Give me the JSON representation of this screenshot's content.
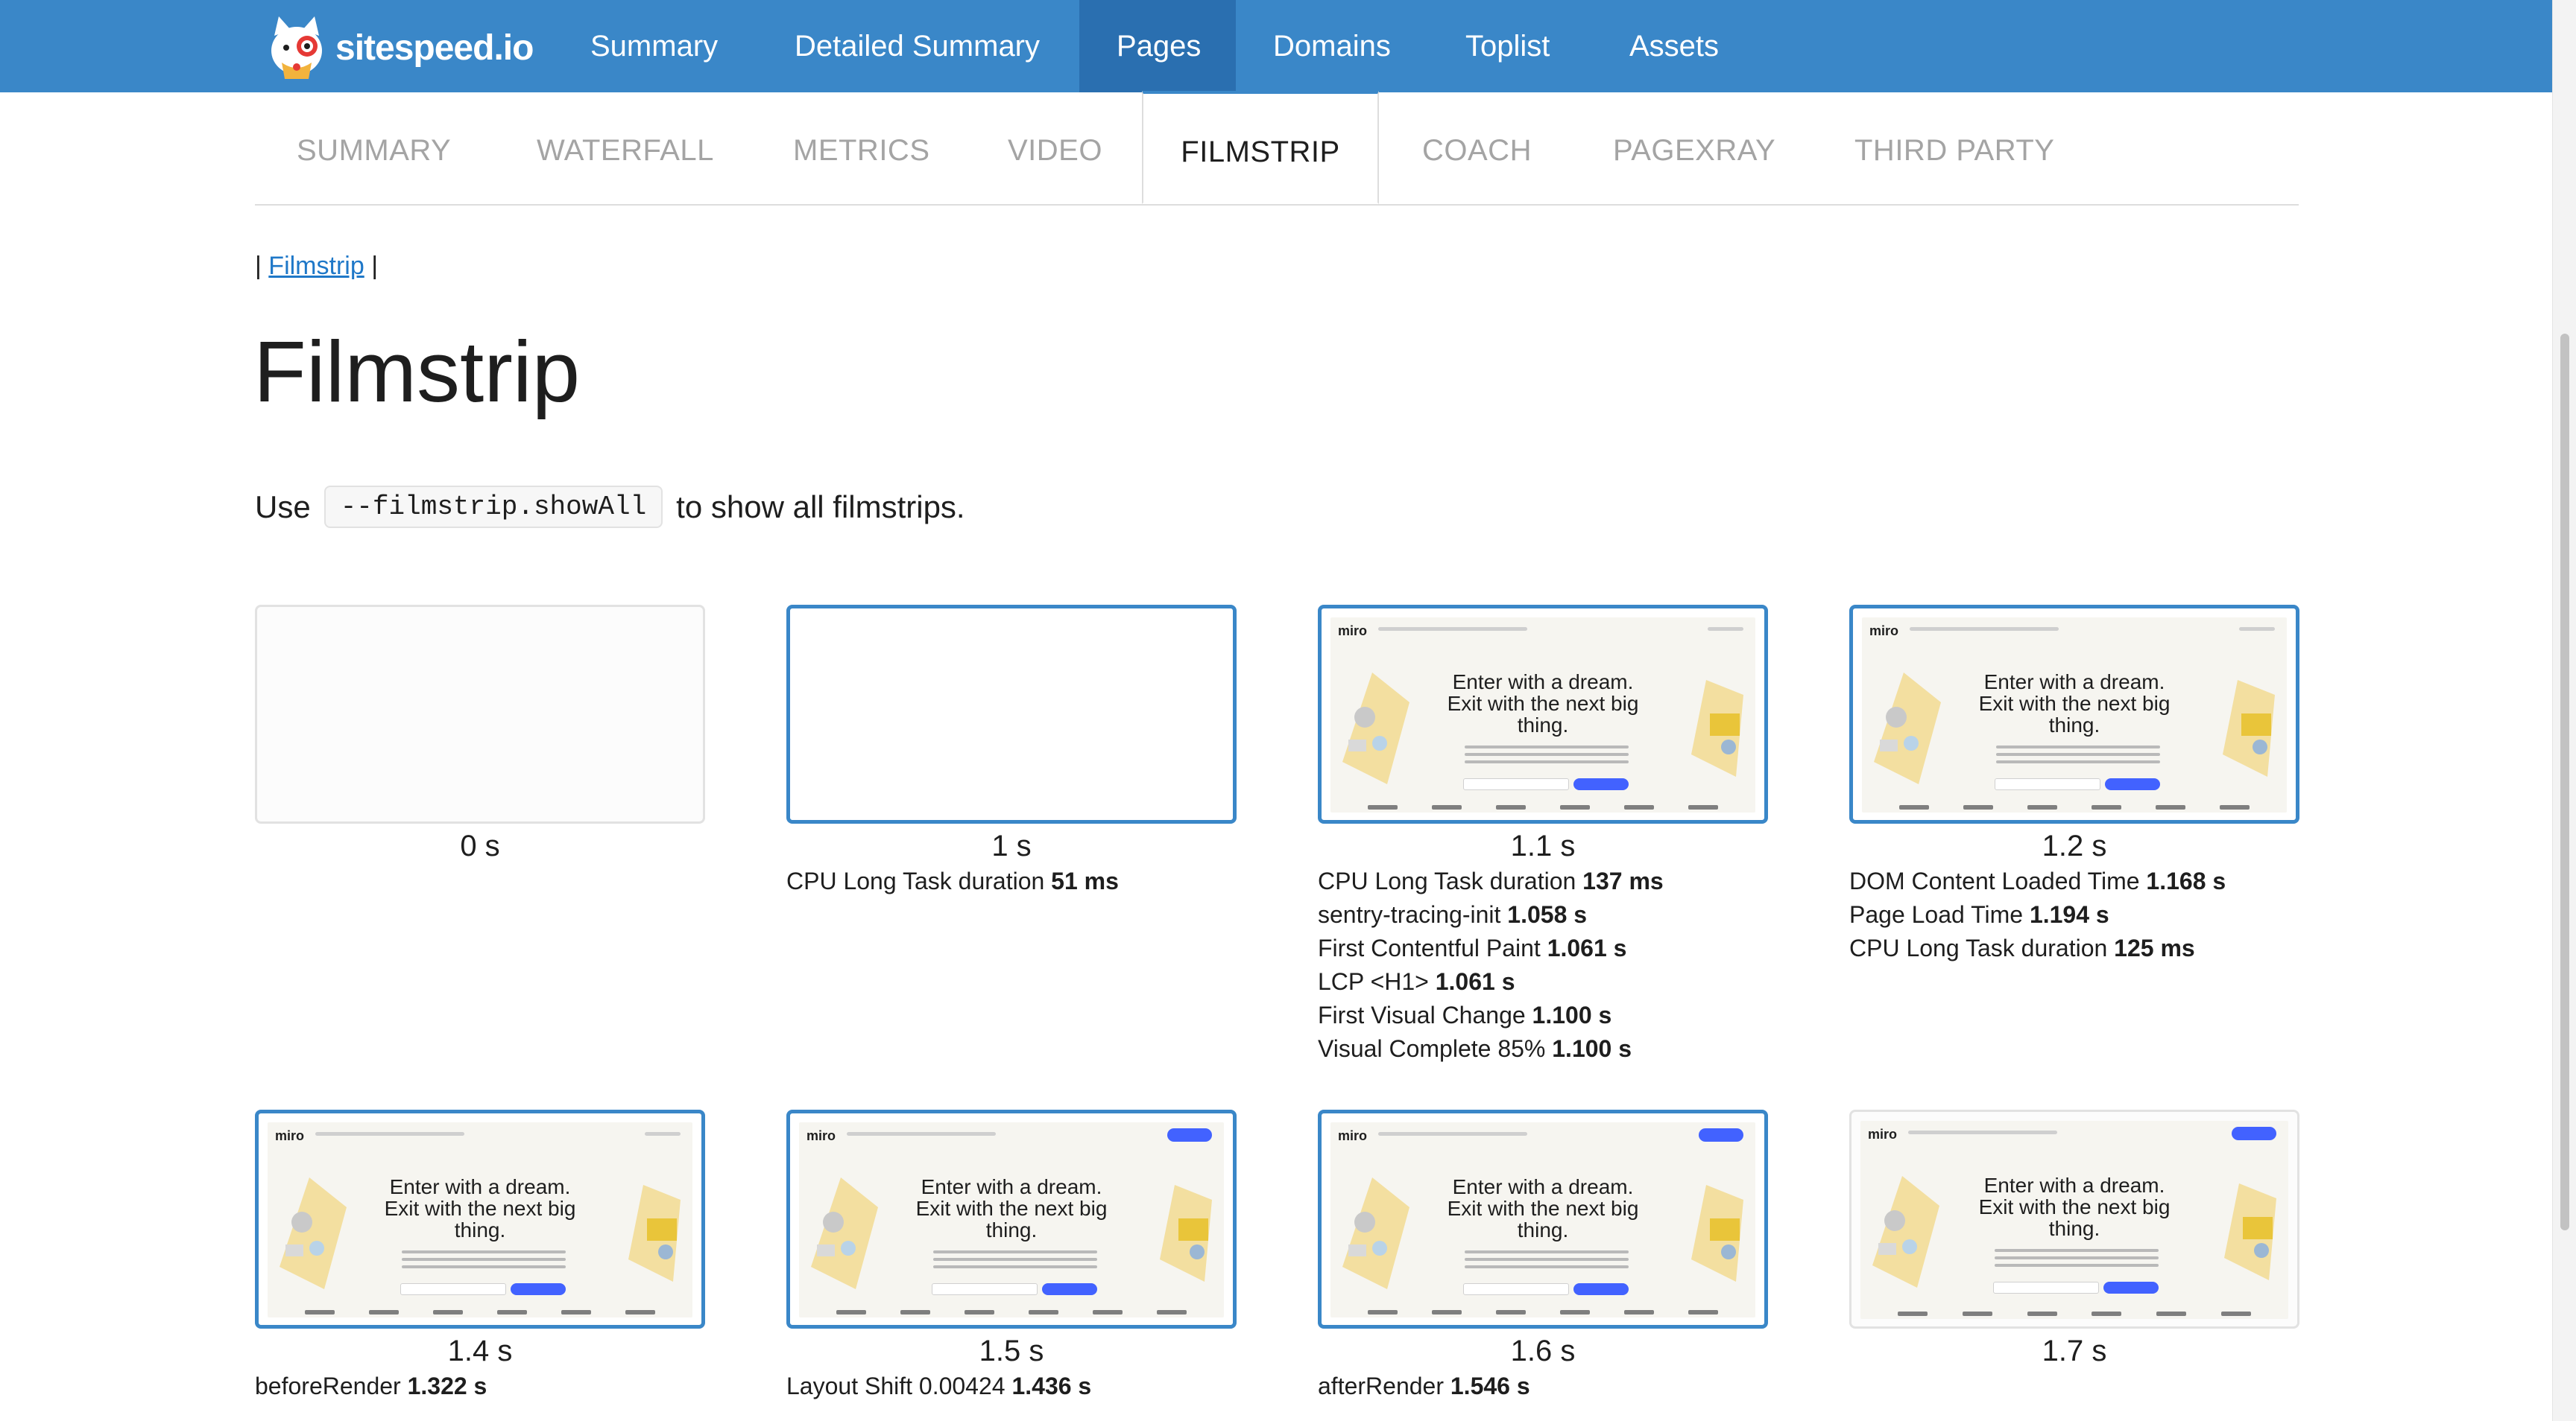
{
  "header": {
    "logo_text": "sitespeed.io",
    "nav": [
      "Summary",
      "Detailed Summary",
      "Pages",
      "Domains",
      "Toplist",
      "Assets"
    ],
    "active_nav": "Pages"
  },
  "tabs": [
    "SUMMARY",
    "WATERFALL",
    "METRICS",
    "VIDEO",
    "FILMSTRIP",
    "COACH",
    "PAGEXRAY",
    "THIRD PARTY"
  ],
  "active_tab": "FILMSTRIP",
  "breadcrumb": {
    "pre": "|",
    "link": "Filmstrip",
    "post": "|"
  },
  "page_title": "Filmstrip",
  "intro": {
    "prefix": "Use",
    "code": "--filmstrip.showAll",
    "suffix": "to show all filmstrips."
  },
  "screenshot_text": {
    "logo": "miro",
    "headline": [
      "Enter with a dream.",
      "Exit with the next big",
      "thing."
    ]
  },
  "frames": [
    {
      "time": "0 s",
      "blank": true,
      "changed": false,
      "metrics": []
    },
    {
      "time": "1 s",
      "blank": true,
      "changed": true,
      "metrics": [
        {
          "label": "CPU Long Task duration",
          "value": "51 ms"
        }
      ]
    },
    {
      "time": "1.1 s",
      "blank": false,
      "changed": true,
      "metrics": [
        {
          "label": "CPU Long Task duration",
          "value": "137 ms"
        },
        {
          "label": "sentry-tracing-init",
          "value": "1.058 s"
        },
        {
          "label": "First Contentful Paint",
          "value": "1.061 s"
        },
        {
          "label": "LCP <H1>",
          "value": "1.061 s"
        },
        {
          "label": "First Visual Change",
          "value": "1.100 s"
        },
        {
          "label": "Visual Complete 85%",
          "value": "1.100 s"
        }
      ]
    },
    {
      "time": "1.2 s",
      "blank": false,
      "changed": true,
      "metrics": [
        {
          "label": "DOM Content Loaded Time",
          "value": "1.168 s"
        },
        {
          "label": "Page Load Time",
          "value": "1.194 s"
        },
        {
          "label": "CPU Long Task duration",
          "value": "125 ms"
        }
      ]
    },
    {
      "time": "1.4 s",
      "blank": false,
      "changed": true,
      "metrics": [
        {
          "label": "beforeRender",
          "value": "1.322 s"
        }
      ]
    },
    {
      "time": "1.5 s",
      "blank": false,
      "changed": true,
      "signup": true,
      "metrics": [
        {
          "label": "Layout Shift 0.00424",
          "value": "1.436 s"
        }
      ]
    },
    {
      "time": "1.6 s",
      "blank": false,
      "changed": true,
      "signup": true,
      "metrics": [
        {
          "label": "afterRender",
          "value": "1.546 s"
        }
      ]
    },
    {
      "time": "1.7 s",
      "blank": false,
      "changed": false,
      "signup": true,
      "metrics": []
    }
  ],
  "colors": {
    "nav_bg": "#3a87c8",
    "nav_active": "#2a6fb0",
    "frame_border": "#3a87c8",
    "miro_blue": "#4262ff"
  }
}
